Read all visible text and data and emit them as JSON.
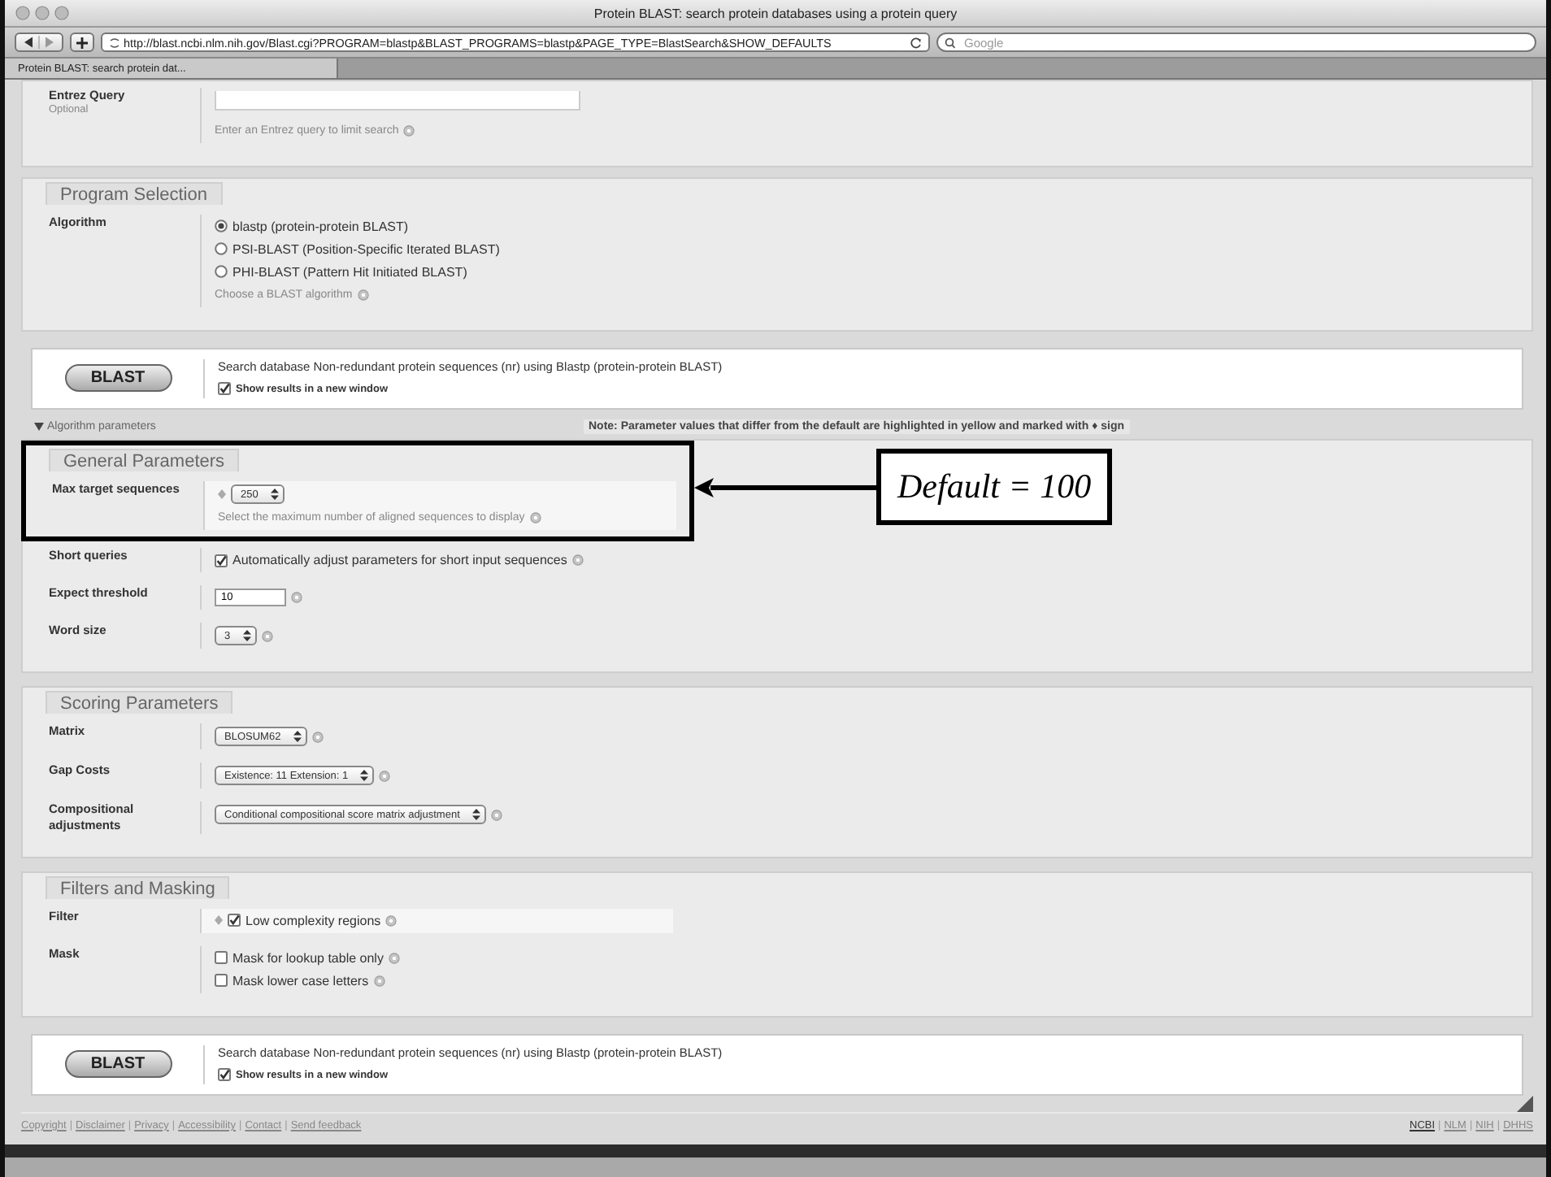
{
  "window": {
    "title": "Protein BLAST: search protein databases using a protein query"
  },
  "toolbar": {
    "url": "http://blast.ncbi.nlm.nih.gov/Blast.cgi?PROGRAM=blastp&BLAST_PROGRAMS=blastp&PAGE_TYPE=BlastSearch&SHOW_DEFAULTS",
    "search_placeholder": "Google"
  },
  "tabs": [
    {
      "label": "Protein BLAST: search protein dat...",
      "selected": true
    }
  ],
  "entrez": {
    "label": "Entrez Query",
    "sublabel": "Optional",
    "hint": "Enter an Entrez query to limit search"
  },
  "program_section": {
    "title": "Program Selection",
    "rows": [
      {
        "label": "Algorithm",
        "changed": false,
        "items": [
          {
            "kind": "radio",
            "label": "blastp (protein-protein BLAST)",
            "selected": true
          },
          {
            "kind": "radio",
            "label": "PSI-BLAST (Position-Specific Iterated BLAST)",
            "selected": false
          },
          {
            "kind": "radio",
            "label": "PHI-BLAST (Pattern Hit Initiated BLAST)",
            "selected": false
          },
          {
            "kind": "hint",
            "text": "Choose a BLAST algorithm",
            "help": true
          }
        ]
      }
    ]
  },
  "blast_bars": [
    {
      "button": "BLAST",
      "description": "Search database Non-redundant protein sequences (nr) using Blastp (protein-protein BLAST)",
      "checkbox": {
        "label": "Show results in a new window",
        "checked": true
      }
    },
    {
      "button": "BLAST",
      "description": "Search database Non-redundant protein sequences (nr) using Blastp (protein-protein BLAST)",
      "checkbox": {
        "label": "Show results in a new window",
        "checked": true
      }
    }
  ],
  "parameters": {
    "toggle": "Algorithm parameters",
    "expanded": true,
    "note": "Note: Parameter values that differ from the default are highlighted in yellow and marked with ♦ sign",
    "sections": [
      {
        "title": "General Parameters",
        "callout": "Default = 100",
        "rows": [
          {
            "label": "Max target sequences",
            "changed": true,
            "items": [
              {
                "kind": "select",
                "value": "250",
                "help": false
              },
              {
                "kind": "hint",
                "text": "Select the maximum number of aligned sequences to display",
                "help": true
              }
            ]
          },
          {
            "label": "Short queries",
            "changed": false,
            "items": [
              {
                "kind": "checkbox",
                "label": "Automatically adjust parameters for short input sequences",
                "checked": true,
                "help": true
              }
            ]
          },
          {
            "label": "Expect threshold",
            "changed": false,
            "items": [
              {
                "kind": "input",
                "value": "10",
                "help": true
              }
            ]
          },
          {
            "label": "Word size",
            "changed": false,
            "items": [
              {
                "kind": "select",
                "value": "3",
                "help": true
              }
            ]
          }
        ]
      },
      {
        "title": "Scoring Parameters",
        "rows": [
          {
            "label": "Matrix",
            "changed": false,
            "items": [
              {
                "kind": "select",
                "value": "BLOSUM62",
                "help": true
              }
            ]
          },
          {
            "label": "Gap Costs",
            "changed": false,
            "items": [
              {
                "kind": "select",
                "value": "Existence: 11 Extension: 1",
                "help": true
              }
            ]
          },
          {
            "label": "Compositional adjustments",
            "changed": false,
            "items": [
              {
                "kind": "select",
                "value": "Conditional compositional score matrix adjustment",
                "help": true
              }
            ]
          }
        ]
      },
      {
        "title": "Filters and Masking",
        "rows": [
          {
            "label": "Filter",
            "changed": true,
            "items": [
              {
                "kind": "checkbox",
                "label": "Low complexity regions",
                "checked": true,
                "help": true
              }
            ]
          },
          {
            "label": "Mask",
            "changed": false,
            "items": [
              {
                "kind": "checkbox",
                "label": "Mask for lookup table only",
                "checked": false,
                "help": true
              },
              {
                "kind": "checkbox",
                "label": "Mask lower case letters",
                "checked": false,
                "help": true
              }
            ]
          }
        ]
      }
    ]
  },
  "footer": {
    "separator": "|",
    "left_links": [
      "Copyright",
      "Disclaimer",
      "Privacy",
      "Accessibility",
      "Contact",
      "Send feedback"
    ],
    "right_links": [
      "NCBI",
      "NLM",
      "NIH",
      "DHHS"
    ]
  }
}
